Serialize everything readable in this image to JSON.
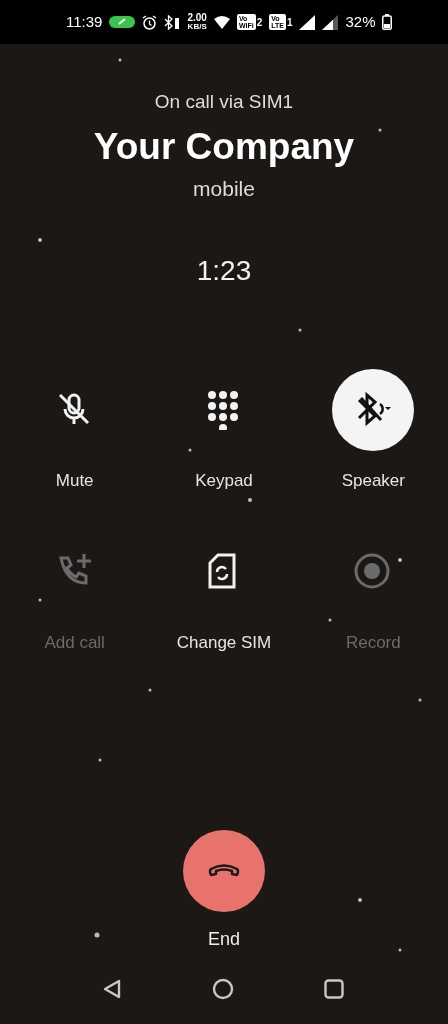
{
  "status_bar": {
    "time": "11:39",
    "speed": "2.00",
    "speed_unit": "KB/S",
    "sim_badges": [
      {
        "top": "Vo",
        "bottom": "WiFi",
        "sim": "2"
      },
      {
        "top": "Vo",
        "bottom": "LTE",
        "sim": "1"
      }
    ],
    "battery": "32%"
  },
  "call": {
    "via": "On call via SIM1",
    "name": "Your Company",
    "number_type": "mobile",
    "duration": "1:23"
  },
  "controls": [
    {
      "kind": "mute",
      "label": "Mute",
      "selected": false,
      "disabled": false
    },
    {
      "kind": "keypad",
      "label": "Keypad",
      "selected": false,
      "disabled": false
    },
    {
      "kind": "speaker",
      "label": "Speaker",
      "selected": true,
      "disabled": false
    },
    {
      "kind": "add_call",
      "label": "Add call",
      "selected": false,
      "disabled": true
    },
    {
      "kind": "change_sim",
      "label": "Change SIM",
      "selected": false,
      "disabled": false
    },
    {
      "kind": "record",
      "label": "Record",
      "selected": false,
      "disabled": true
    }
  ],
  "end_button": {
    "label": "End"
  }
}
